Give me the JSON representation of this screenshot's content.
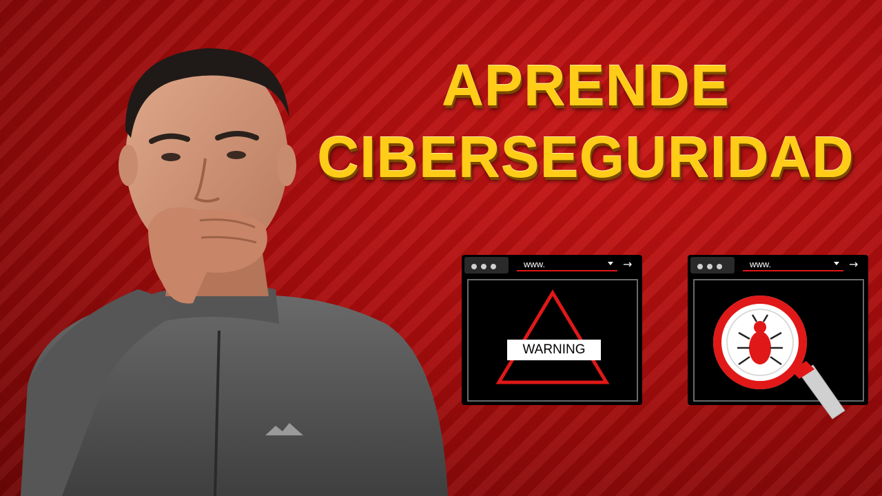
{
  "headline": {
    "line1": "APRENDE",
    "line2": "CIBERSEGURIDAD"
  },
  "windows": [
    {
      "url": "www.",
      "go_icon": "→",
      "content": "warning-triangle-icon",
      "label": "WARNING"
    },
    {
      "url": "www.",
      "go_icon": "→",
      "content": "bug-magnifier-icon"
    }
  ],
  "colors": {
    "background": "#b00e0e",
    "headline": "#ffcc17",
    "accent": "#e01818"
  }
}
